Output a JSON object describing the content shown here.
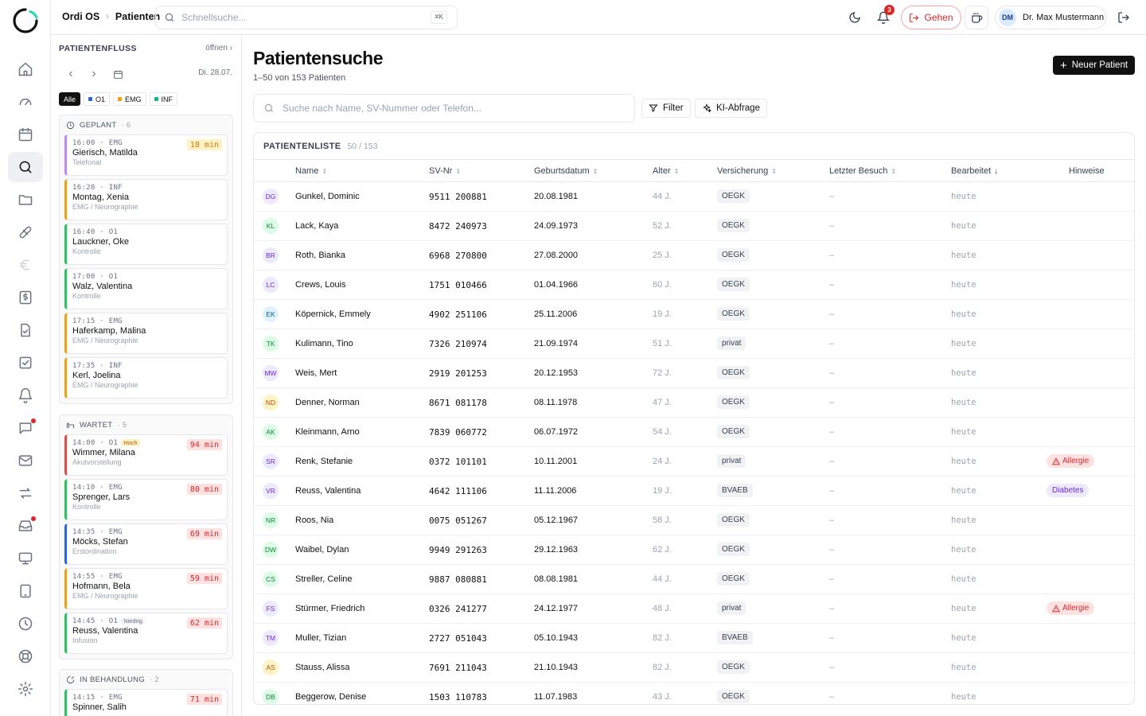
{
  "topbar": {
    "app": "Ordi OS",
    "page": "Patienten",
    "search_placeholder": "Schnellsuche...",
    "kbd": "⌘K",
    "notif_count": "3",
    "gehen_label": "Gehen",
    "user_initials": "DM",
    "user_name": "Dr. Max Mustermann"
  },
  "rail": {
    "items": [
      "home",
      "gauge",
      "calendar",
      "search",
      "folder",
      "pill",
      "euro",
      "billing",
      "document-check",
      "checklist",
      "bell",
      "chat",
      "mail",
      "swap",
      "inbox",
      "monitor",
      "tablet",
      "clock",
      "help",
      "settings"
    ],
    "active": "search"
  },
  "flow": {
    "title": "PATIENTENFLUSS",
    "open_label": "öffnen ›",
    "date": "Di. 28.07.",
    "filters": [
      {
        "label": "Alle",
        "color": ""
      },
      {
        "label": "O1",
        "color": "#2563eb"
      },
      {
        "label": "EMG",
        "color": "#f59e0b"
      },
      {
        "label": "INF",
        "color": "#10b981"
      }
    ],
    "groups": [
      {
        "title": "GEPLANT",
        "count": "· 6",
        "cards": [
          {
            "time": "16:00 · EMG",
            "name": "Gierisch, Matilda",
            "sub": "Telefonat",
            "wait": "18 min",
            "accent": "#c084fc",
            "wait_kind": "amber",
            "prio": ""
          },
          {
            "time": "16:20 · INF",
            "name": "Montag, Xenia",
            "sub": "EMG / Neurographie",
            "wait": "",
            "accent": "#f59e0b",
            "wait_kind": "",
            "prio": ""
          },
          {
            "time": "16:40 · O1",
            "name": "Lauckner, Oke",
            "sub": "Kontrolle",
            "wait": "",
            "accent": "#22c55e",
            "wait_kind": "",
            "prio": ""
          },
          {
            "time": "17:00 · O1",
            "name": "Walz, Valentina",
            "sub": "Kontrolle",
            "wait": "",
            "accent": "#22c55e",
            "wait_kind": "",
            "prio": ""
          },
          {
            "time": "17:15 · EMG",
            "name": "Haferkamp, Malina",
            "sub": "EMG / Neurographie",
            "wait": "",
            "accent": "#f59e0b",
            "wait_kind": "",
            "prio": ""
          },
          {
            "time": "17:35 · INF",
            "name": "Kerl, Joelina",
            "sub": "EMG / Neurographie",
            "wait": "",
            "accent": "#f59e0b",
            "wait_kind": "",
            "prio": ""
          }
        ]
      },
      {
        "title": "WARTET",
        "count": "· 5",
        "cards": [
          {
            "time": "14:00 · O1",
            "name": "Wimmer, Milana",
            "sub": "Akutvorstellung",
            "wait": "94 min",
            "accent": "#ef4444",
            "wait_kind": "red",
            "prio": "Hoch"
          },
          {
            "time": "14:10 · EMG",
            "name": "Sprenger, Lars",
            "sub": "Kontrolle",
            "wait": "80 min",
            "accent": "#22c55e",
            "wait_kind": "red",
            "prio": ""
          },
          {
            "time": "14:35 · EMG",
            "name": "Möcks, Stefan",
            "sub": "Erstordination",
            "wait": "69 min",
            "accent": "#2563eb",
            "wait_kind": "red",
            "prio": ""
          },
          {
            "time": "14:55 · EMG",
            "name": "Hofmann, Bela",
            "sub": "EMG / Neurographie",
            "wait": "59 min",
            "accent": "#f59e0b",
            "wait_kind": "red",
            "prio": ""
          },
          {
            "time": "14:45 · O1",
            "name": "Reuss, Valentina",
            "sub": "Infusion",
            "wait": "62 min",
            "accent": "#22c55e",
            "wait_kind": "red",
            "prio": "Niedrig"
          }
        ]
      },
      {
        "title": "IN BEHANDLUNG",
        "count": "· 2",
        "cards": [
          {
            "time": "14:15 · EMG",
            "name": "Spinner, Salih",
            "sub": "",
            "wait": "71 min",
            "accent": "#22c55e",
            "wait_kind": "red",
            "prio": ""
          }
        ]
      }
    ]
  },
  "main": {
    "title": "Patientensuche",
    "subtitle": "1–50 von 153 Patienten",
    "new_patient": "Neuer Patient",
    "search_placeholder": "Suche nach Name, SV-Nummer oder Telefon...",
    "filter_label": "Filter",
    "ai_label": "KI-Abfrage",
    "list_title": "PATIENTENLISTE",
    "list_count": "50 / 153",
    "columns": {
      "name": "Name",
      "svnr": "SV-Nr",
      "dob": "Geburtsdatum",
      "age": "Alter",
      "ins": "Versicherung",
      "last": "Letzter Besuch",
      "edit": "Bearbeitet",
      "notes": "Hinweise"
    },
    "rows": [
      {
        "initials": "DG",
        "name": "Gunkel, Dominic",
        "svnr": "9511 200881",
        "dob": "20.08.1981",
        "age": "44 J.",
        "ins": "OEGK",
        "last": "–",
        "edit": "heute",
        "note": "",
        "av": "#ede9fe",
        "avc": "#6d28d9"
      },
      {
        "initials": "KL",
        "name": "Lack, Kaya",
        "svnr": "8472 240973",
        "dob": "24.09.1973",
        "age": "52 J.",
        "ins": "OEGK",
        "last": "–",
        "edit": "heute",
        "note": "",
        "av": "#dcfce7",
        "avc": "#15803d"
      },
      {
        "initials": "BR",
        "name": "Roth, Bianka",
        "svnr": "6968 270800",
        "dob": "27.08.2000",
        "age": "25 J.",
        "ins": "OEGK",
        "last": "–",
        "edit": "heute",
        "note": "",
        "av": "#ede9fe",
        "avc": "#6d28d9"
      },
      {
        "initials": "LC",
        "name": "Crews, Louis",
        "svnr": "1751 010466",
        "dob": "01.04.1966",
        "age": "60 J.",
        "ins": "OEGK",
        "last": "–",
        "edit": "heute",
        "note": "",
        "av": "#ede9fe",
        "avc": "#6d28d9"
      },
      {
        "initials": "EK",
        "name": "Köpernick, Emmely",
        "svnr": "4902 251106",
        "dob": "25.11.2006",
        "age": "19 J.",
        "ins": "OEGK",
        "last": "–",
        "edit": "heute",
        "note": "",
        "av": "#e0f2fe",
        "avc": "#075985"
      },
      {
        "initials": "TK",
        "name": "Kulimann, Tino",
        "svnr": "7326 210974",
        "dob": "21.09.1974",
        "age": "51 J.",
        "ins": "privat",
        "last": "–",
        "edit": "heute",
        "note": "",
        "av": "#dcfce7",
        "avc": "#15803d"
      },
      {
        "initials": "MW",
        "name": "Weis, Mert",
        "svnr": "2919 201253",
        "dob": "20.12.1953",
        "age": "72 J.",
        "ins": "OEGK",
        "last": "–",
        "edit": "heute",
        "note": "",
        "av": "#ede9fe",
        "avc": "#6d28d9"
      },
      {
        "initials": "ND",
        "name": "Denner, Norman",
        "svnr": "8671 081178",
        "dob": "08.11.1978",
        "age": "47 J.",
        "ins": "OEGK",
        "last": "–",
        "edit": "heute",
        "note": "",
        "av": "#fef3c7",
        "avc": "#b45309"
      },
      {
        "initials": "AK",
        "name": "Kleinmann, Arno",
        "svnr": "7839 060772",
        "dob": "06.07.1972",
        "age": "54 J.",
        "ins": "OEGK",
        "last": "–",
        "edit": "heute",
        "note": "",
        "av": "#dcfce7",
        "avc": "#15803d"
      },
      {
        "initials": "SR",
        "name": "Renk, Stefanie",
        "svnr": "0372 101101",
        "dob": "10.11.2001",
        "age": "24 J.",
        "ins": "privat",
        "last": "–",
        "edit": "heute",
        "note": "Allergie",
        "av": "#ede9fe",
        "avc": "#6d28d9"
      },
      {
        "initials": "VR",
        "name": "Reuss, Valentina",
        "svnr": "4642 111106",
        "dob": "11.11.2006",
        "age": "19 J.",
        "ins": "BVAEB",
        "last": "–",
        "edit": "heute",
        "note": "Diabetes",
        "av": "#ede9fe",
        "avc": "#6d28d9"
      },
      {
        "initials": "NR",
        "name": "Roos, Nia",
        "svnr": "0075 051267",
        "dob": "05.12.1967",
        "age": "58 J.",
        "ins": "OEGK",
        "last": "–",
        "edit": "heute",
        "note": "",
        "av": "#dcfce7",
        "avc": "#15803d"
      },
      {
        "initials": "DW",
        "name": "Waibel, Dylan",
        "svnr": "9949 291263",
        "dob": "29.12.1963",
        "age": "62 J.",
        "ins": "OEGK",
        "last": "–",
        "edit": "heute",
        "note": "",
        "av": "#dcfce7",
        "avc": "#15803d"
      },
      {
        "initials": "CS",
        "name": "Streller, Celine",
        "svnr": "9887 080881",
        "dob": "08.08.1981",
        "age": "44 J.",
        "ins": "OEGK",
        "last": "–",
        "edit": "heute",
        "note": "",
        "av": "#dcfce7",
        "avc": "#15803d"
      },
      {
        "initials": "FS",
        "name": "Stürmer, Friedrich",
        "svnr": "0326 241277",
        "dob": "24.12.1977",
        "age": "48 J.",
        "ins": "privat",
        "last": "–",
        "edit": "heute",
        "note": "Allergie",
        "av": "#ede9fe",
        "avc": "#6d28d9"
      },
      {
        "initials": "TM",
        "name": "Muller, Tizian",
        "svnr": "2727 051043",
        "dob": "05.10.1943",
        "age": "82 J.",
        "ins": "BVAEB",
        "last": "–",
        "edit": "heute",
        "note": "",
        "av": "#ede9fe",
        "avc": "#6d28d9"
      },
      {
        "initials": "AS",
        "name": "Stauss, Alissa",
        "svnr": "7691 211043",
        "dob": "21.10.1943",
        "age": "82 J.",
        "ins": "OEGK",
        "last": "–",
        "edit": "heute",
        "note": "",
        "av": "#fef3c7",
        "avc": "#b45309"
      },
      {
        "initials": "DB",
        "name": "Beggerow, Denise",
        "svnr": "1503 110783",
        "dob": "11.07.1983",
        "age": "43 J.",
        "ins": "OEGK",
        "last": "–",
        "edit": "heute",
        "note": "",
        "av": "#dcfce7",
        "avc": "#15803d"
      }
    ]
  }
}
